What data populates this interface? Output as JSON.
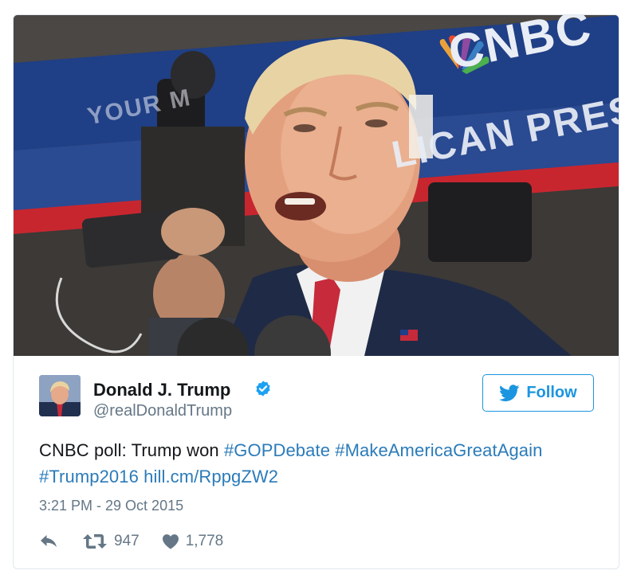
{
  "tweet": {
    "author": {
      "name": "Donald J. Trump",
      "handle": "@realDonaldTrump",
      "verified": true,
      "avatar_icon": "profile-photo"
    },
    "follow_label": "Follow",
    "text_plain": "CNBC poll: Trump won ",
    "hashtags": [
      "#GOPDebate",
      "#MakeAmericaGreatAgain",
      "#Trump2016"
    ],
    "link": "hill.cm/RppgZW2",
    "timestamp": "3:21 PM - 29 Oct 2015",
    "actions": {
      "reply_icon": "reply-icon",
      "retweet_icon": "retweet-icon",
      "retweet_count": "947",
      "like_icon": "heart-icon",
      "like_count": "1,778"
    },
    "photo": {
      "banner_logo": "CNBC",
      "banner_text_right": "LICAN PRES",
      "banner_text_left": "YOUR M"
    }
  },
  "colors": {
    "link": "#2b7bb9",
    "follow": "#1b95e0",
    "text": "#14171a",
    "muted": "#657786",
    "verified": "#1da1f2"
  }
}
